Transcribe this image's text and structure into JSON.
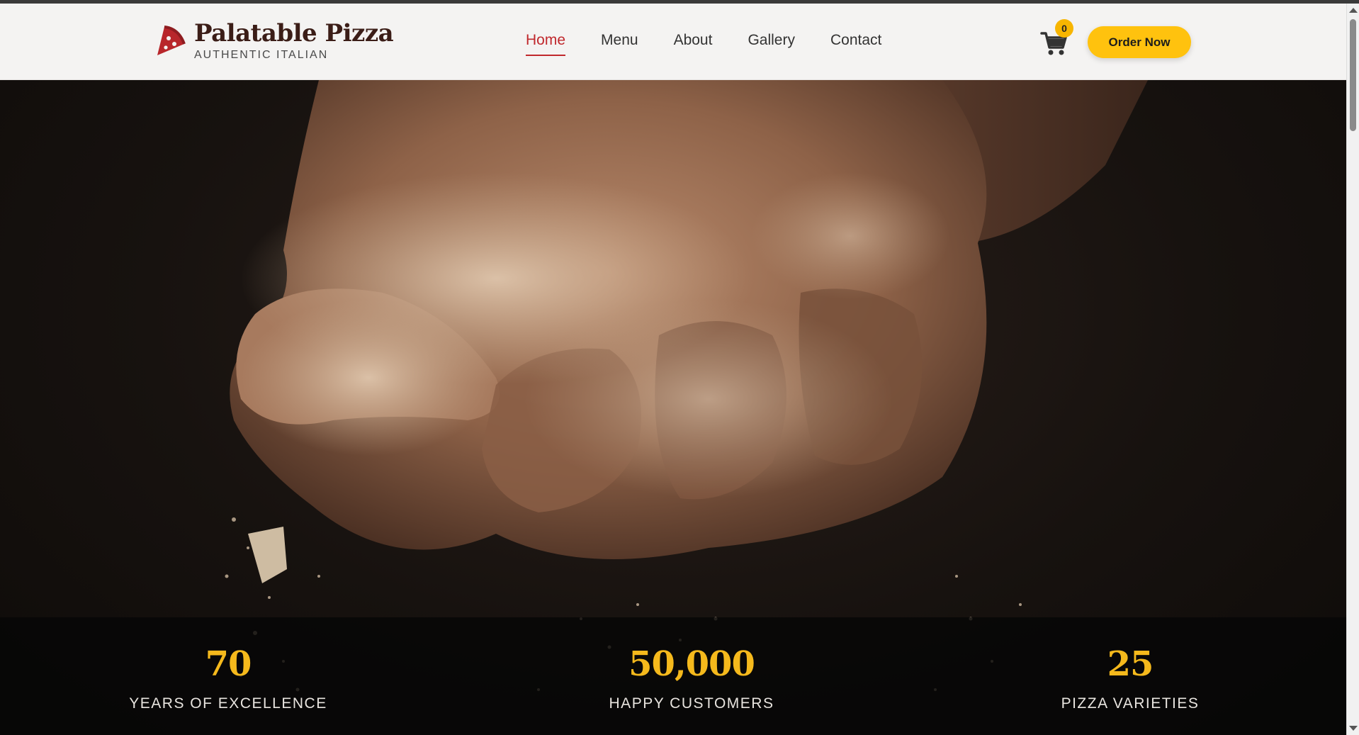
{
  "brand": {
    "name": "Palatable Pizza",
    "tagline": "AUTHENTIC ITALIAN",
    "logo_icon": "pizza-slice-icon",
    "logo_color": "#b8262b"
  },
  "nav": {
    "items": [
      {
        "label": "Home",
        "active": true
      },
      {
        "label": "Menu",
        "active": false
      },
      {
        "label": "About",
        "active": false
      },
      {
        "label": "Gallery",
        "active": false
      },
      {
        "label": "Contact",
        "active": false
      }
    ],
    "active_color": "#c0282d"
  },
  "cart": {
    "icon": "shopping-cart-icon",
    "count": "0"
  },
  "cta": {
    "label": "Order Now",
    "color": "#ffc20e"
  },
  "hero": {
    "image": "hand-sprinkling-flour-photo"
  },
  "stats": [
    {
      "value": "70",
      "label": "YEARS OF EXCELLENCE"
    },
    {
      "value": "50,000",
      "label": "HAPPY CUSTOMERS"
    },
    {
      "value": "25",
      "label": "PIZZA VARIETIES"
    }
  ],
  "colors": {
    "accent_gold": "#f5b91c",
    "brand_dark": "#3b1d17"
  }
}
